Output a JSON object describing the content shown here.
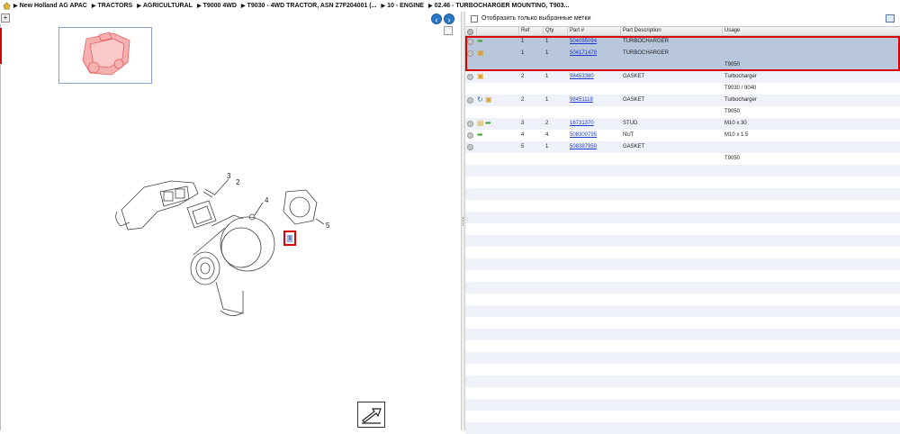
{
  "breadcrumb": {
    "items": [
      "New Holland AG APAC",
      "TRACTORS",
      "AGRICULTURAL",
      "T9000 4WD",
      "T9030 - 4WD TRACTOR, ASN Z7F204001 (...",
      "10 - ENGINE",
      "02.46 - TURBOCHARGER MOUNTING, T903..."
    ]
  },
  "diagram": {
    "callouts": [
      "1",
      "2",
      "3",
      "4",
      "5"
    ]
  },
  "filter": {
    "label": "Отобразить только выбранные метки",
    "checked": false
  },
  "table": {
    "headers": {
      "ref": "Ref",
      "qty": "Qty",
      "part": "Part #",
      "desc": "Part Description",
      "usage": "Usage"
    },
    "rows": [
      {
        "ref": "1",
        "qty": "1",
        "part": "504095094",
        "desc": "TURBOCHARGER",
        "usage": "",
        "icons": [
          "green-arrow-icon"
        ],
        "selected": true
      },
      {
        "ref": "1",
        "qty": "1",
        "part": "504171478",
        "desc": "TURBOCHARGER",
        "usage": "",
        "icons": [
          "package-icon"
        ],
        "selected": true
      },
      {
        "ref": "",
        "qty": "",
        "part": "",
        "desc": "",
        "usage": "T9050",
        "icons": [],
        "selected": true
      },
      {
        "ref": "2",
        "qty": "1",
        "part": "98453380",
        "desc": "GASKET",
        "usage": "Turbocharger",
        "icons": [
          "package-icon"
        ],
        "selected": false
      },
      {
        "ref": "",
        "qty": "",
        "part": "",
        "desc": "",
        "usage": "T9030 / 9040",
        "icons": [],
        "selected": false
      },
      {
        "ref": "2",
        "qty": "1",
        "part": "98451118",
        "desc": "GASKET",
        "usage": "Turbocharger",
        "icons": [
          "refresh-icon",
          "package-icon"
        ],
        "selected": false
      },
      {
        "ref": "",
        "qty": "",
        "part": "",
        "desc": "",
        "usage": "T9050",
        "icons": [],
        "selected": false
      },
      {
        "ref": "3",
        "qty": "2",
        "part": "16731370",
        "desc": "STUD",
        "usage": "M10 x 30",
        "icons": [
          "note-icon",
          "green-arrow-icon"
        ],
        "selected": false
      },
      {
        "ref": "4",
        "qty": "4",
        "part": "508300795",
        "desc": "NUT",
        "usage": "M10 x 1.5",
        "icons": [
          "green-arrow-icon"
        ],
        "selected": false
      },
      {
        "ref": "5",
        "qty": "1",
        "part": "508387950",
        "desc": "GASKET",
        "usage": "",
        "icons": [],
        "selected": false
      },
      {
        "ref": "",
        "qty": "",
        "part": "",
        "desc": "",
        "usage": "T9050",
        "icons": [],
        "selected": false
      }
    ]
  },
  "colors": {
    "selected_row": "#b8c7db",
    "highlight_border": "#dd0000",
    "link": "#1a3ad0",
    "stripe": "#eef2f8"
  }
}
